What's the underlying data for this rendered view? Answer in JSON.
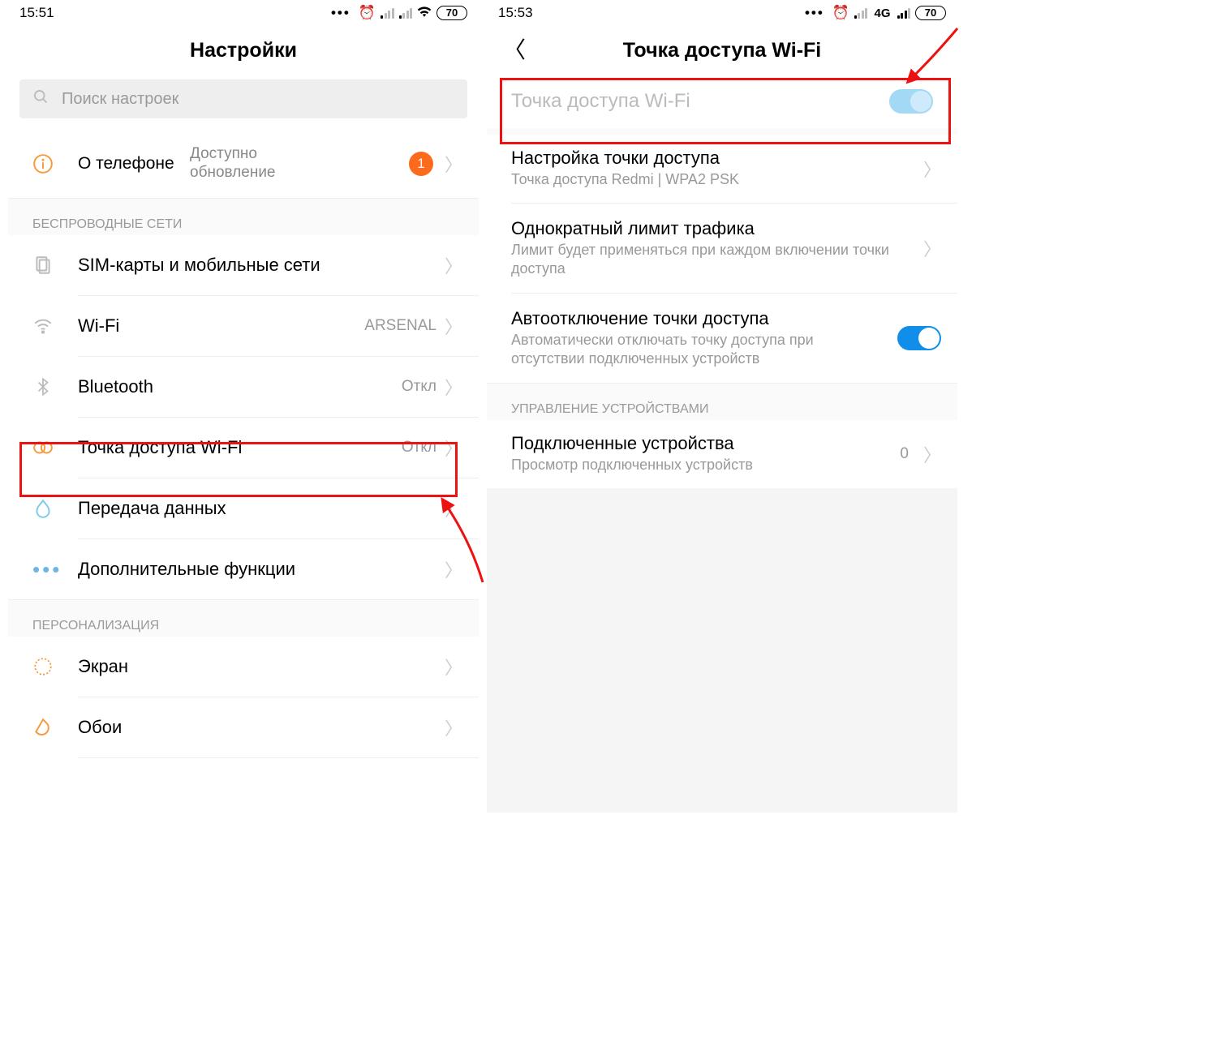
{
  "left": {
    "status": {
      "time": "15:51",
      "battery": "70"
    },
    "title": "Настройки",
    "search_placeholder": "Поиск настроек",
    "about": {
      "label": "О телефоне",
      "sub": "Доступно\nобновление",
      "badge": "1"
    },
    "section_wireless": "БЕСПРОВОДНЫЕ СЕТИ",
    "rows": {
      "sim": {
        "label": "SIM-карты и мобильные сети"
      },
      "wifi": {
        "label": "Wi-Fi",
        "value": "ARSENAL"
      },
      "bt": {
        "label": "Bluetooth",
        "value": "Откл"
      },
      "hotspot": {
        "label": "Точка доступа Wi-Fi",
        "value": "Откл"
      },
      "data": {
        "label": "Передача данных"
      },
      "more": {
        "label": "Дополнительные функции"
      }
    },
    "section_personal": "ПЕРСОНАЛИЗАЦИЯ",
    "rows2": {
      "display": {
        "label": "Экран"
      },
      "wall": {
        "label": "Обои"
      }
    }
  },
  "right": {
    "status": {
      "time": "15:53",
      "net": "4G",
      "battery": "70"
    },
    "title": "Точка доступа Wi-Fi",
    "toggle_title": "Точка доступа Wi-Fi",
    "items": {
      "setup": {
        "label": "Настройка точки доступа",
        "sub": "Точка доступа Redmi | WPA2 PSK"
      },
      "limit": {
        "label": "Однократный лимит трафика",
        "sub": "Лимит будет применяться при каждом включении точки доступа"
      },
      "auto": {
        "label": "Автоотключение точки доступа",
        "sub": "Автоматически отключать точку доступа при отсутствии подключенных устройств"
      }
    },
    "section_devices": "УПРАВЛЕНИЕ УСТРОЙСТВАМИ",
    "connected": {
      "label": "Подключенные устройства",
      "sub": "Просмотр подключенных устройств",
      "value": "0"
    }
  }
}
